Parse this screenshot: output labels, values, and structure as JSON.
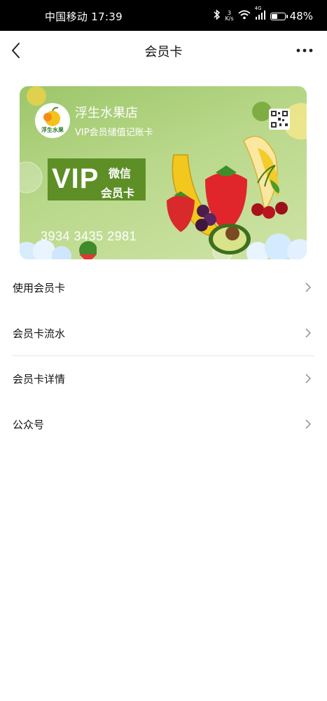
{
  "status_bar": {
    "carrier_time": "中国移动 17:39",
    "net_speed_value": "3",
    "net_speed_unit": "K/s",
    "network_type": "4G",
    "battery": "48%",
    "battery_level": 0.48,
    "icons": [
      "bluetooth-icon",
      "wifi-icon",
      "signal-icon",
      "battery-icon"
    ]
  },
  "navbar": {
    "title": "会员卡",
    "back_icon": "chevron-left-icon",
    "more_icon": "more-horizontal-icon"
  },
  "card": {
    "shop_name": "浮生水果店",
    "subtitle": "VIP会员储值记账卡",
    "logo_text": "浮生水果",
    "vip_label": "VIP",
    "wechat_label": "微信",
    "member_card_label": "会员卡",
    "card_number": "3934 3435 2981",
    "colors": {
      "card_bg": "#b0d07c",
      "vip_block": "#5d8f26"
    }
  },
  "menu": {
    "items": [
      {
        "label": "使用会员卡"
      },
      {
        "label": "会员卡流水"
      },
      {
        "label": "会员卡详情"
      },
      {
        "label": "公众号"
      }
    ]
  }
}
